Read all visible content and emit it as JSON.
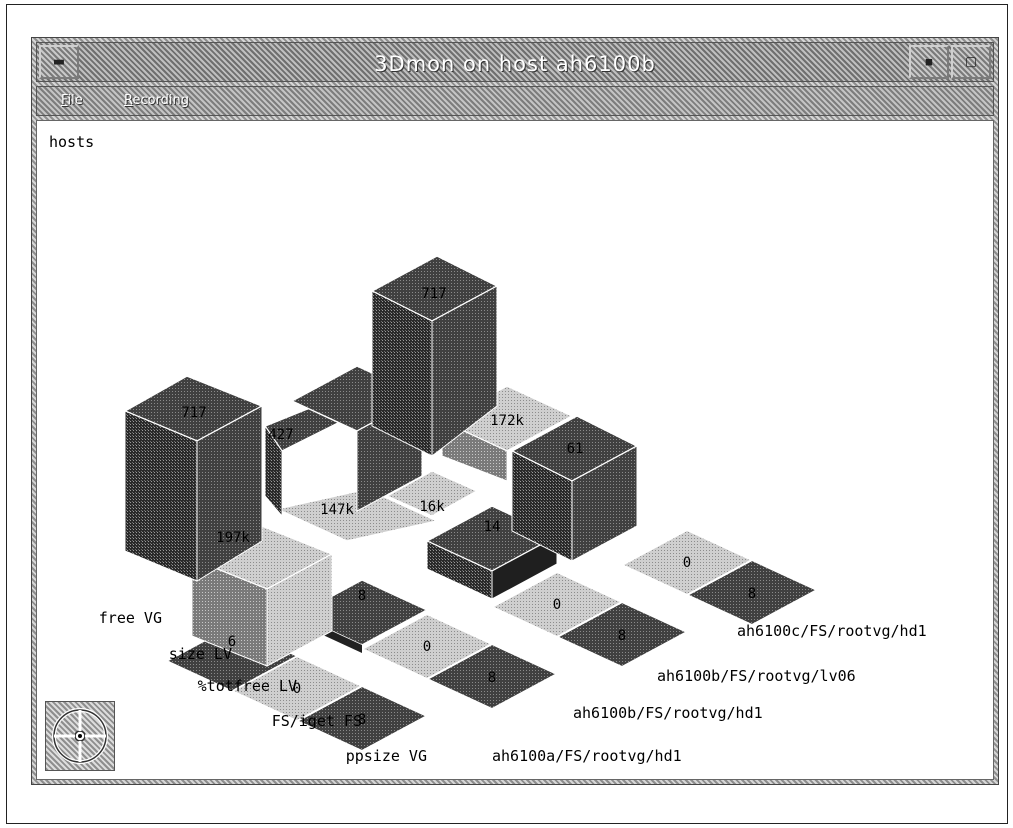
{
  "window": {
    "title": "3Dmon on host ah6100b",
    "menu": [
      {
        "label": "File",
        "mnemonic": "F"
      },
      {
        "label": "Recording",
        "mnemonic": "R"
      }
    ]
  },
  "content": {
    "group_label": "hosts",
    "row_axis": [
      "free VG",
      "size LV",
      "%totfree LV",
      "FS/iget FS",
      "ppsize VG"
    ],
    "column_axis": [
      "ah6100a/FS/rootvg/hd1",
      "ah6100b/FS/rootvg/hd1",
      "ah6100b/FS/rootvg/lv06",
      "ah6100c/FS/rootvg/hd1"
    ],
    "cells": [
      [
        "717",
        "427",
        "717",
        "61"
      ],
      [
        "197k",
        "147k",
        "16k",
        "172k"
      ],
      [
        "6",
        "8",
        "14",
        ""
      ],
      [
        "0",
        "0",
        "0",
        "0"
      ],
      [
        "8",
        "8",
        "8",
        "8"
      ]
    ]
  }
}
